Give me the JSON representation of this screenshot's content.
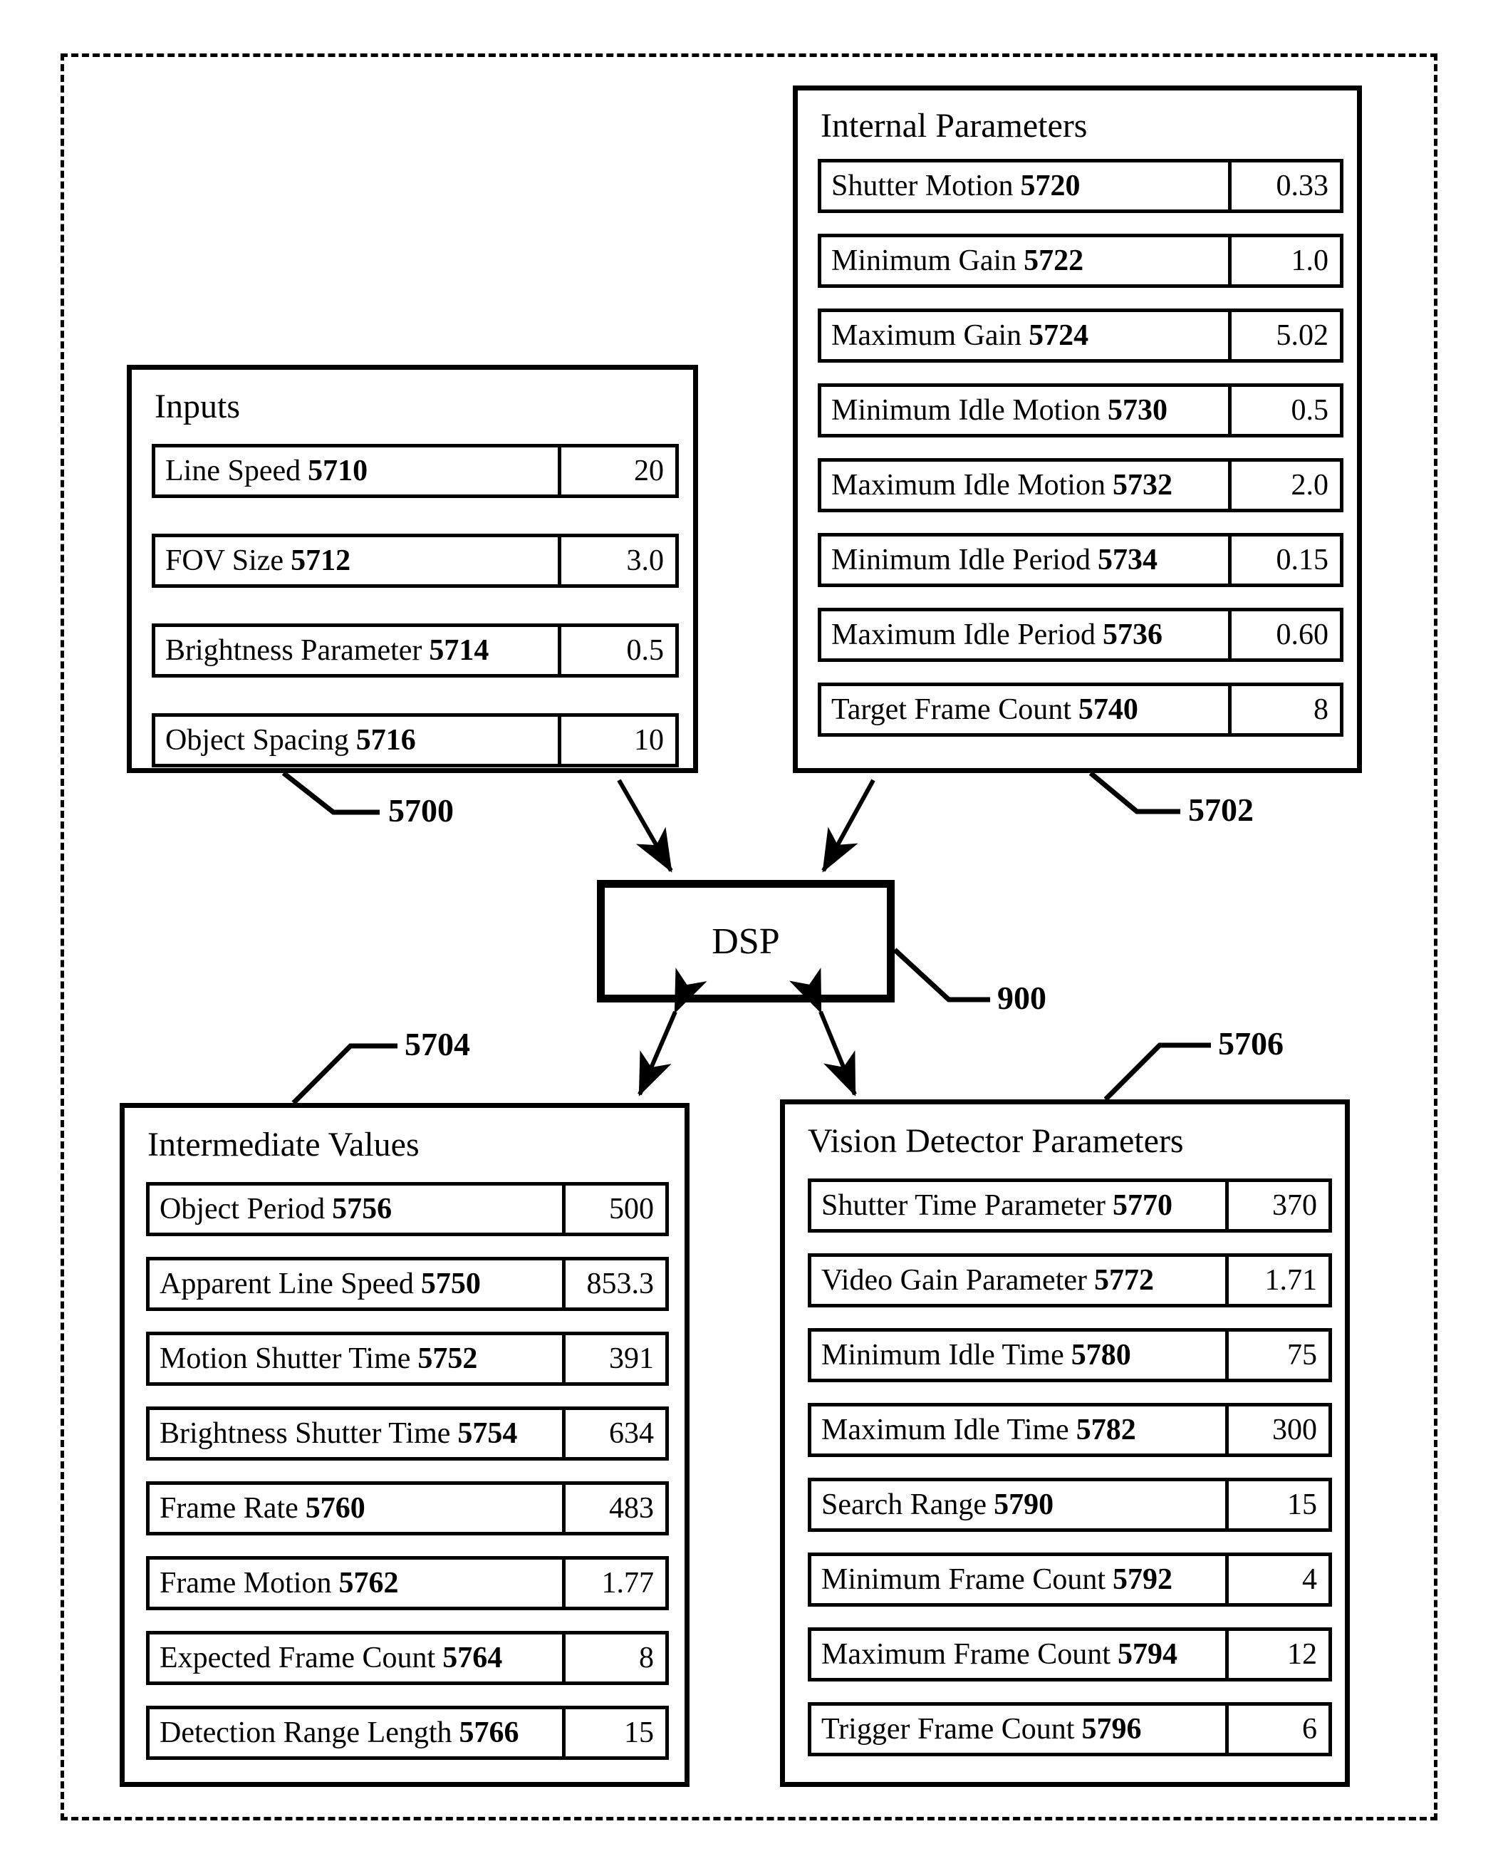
{
  "figure": {
    "central_block": {
      "label": "DSP",
      "ref": "900"
    }
  },
  "panels": {
    "inputs": {
      "title": "Inputs",
      "ref": "5700",
      "rows": [
        {
          "label": "Line Speed",
          "ref": "5710",
          "value": "20"
        },
        {
          "label": "FOV Size",
          "ref": "5712",
          "value": "3.0"
        },
        {
          "label": "Brightness Parameter",
          "ref": "5714",
          "value": "0.5"
        },
        {
          "label": "Object Spacing",
          "ref": "5716",
          "value": "10"
        }
      ]
    },
    "internal_parameters": {
      "title": "Internal Parameters",
      "ref": "5702",
      "rows": [
        {
          "label": "Shutter Motion",
          "ref": "5720",
          "value": "0.33"
        },
        {
          "label": "Minimum Gain",
          "ref": "5722",
          "value": "1.0"
        },
        {
          "label": "Maximum Gain",
          "ref": "5724",
          "value": "5.02"
        },
        {
          "label": "Minimum Idle Motion",
          "ref": "5730",
          "value": "0.5"
        },
        {
          "label": "Maximum Idle Motion",
          "ref": "5732",
          "value": "2.0"
        },
        {
          "label": "Minimum Idle Period",
          "ref": "5734",
          "value": "0.15"
        },
        {
          "label": "Maximum Idle Period",
          "ref": "5736",
          "value": "0.60"
        },
        {
          "label": "Target Frame Count",
          "ref": "5740",
          "value": "8"
        }
      ]
    },
    "intermediate_values": {
      "title": "Intermediate Values",
      "ref": "5704",
      "rows": [
        {
          "label": "Object Period",
          "ref": "5756",
          "value": "500"
        },
        {
          "label": "Apparent Line Speed",
          "ref": "5750",
          "value": "853.3"
        },
        {
          "label": "Motion Shutter Time",
          "ref": "5752",
          "value": "391"
        },
        {
          "label": "Brightness Shutter Time",
          "ref": "5754",
          "value": "634"
        },
        {
          "label": "Frame Rate",
          "ref": "5760",
          "value": "483"
        },
        {
          "label": "Frame Motion",
          "ref": "5762",
          "value": "1.77"
        },
        {
          "label": "Expected Frame Count",
          "ref": "5764",
          "value": "8"
        },
        {
          "label": "Detection Range Length",
          "ref": "5766",
          "value": "15"
        }
      ]
    },
    "vision_detector_parameters": {
      "title": "Vision Detector Parameters",
      "ref": "5706",
      "rows": [
        {
          "label": "Shutter Time Parameter",
          "ref": "5770",
          "value": "370"
        },
        {
          "label": "Video Gain Parameter",
          "ref": "5772",
          "value": "1.71"
        },
        {
          "label": "Minimum Idle Time",
          "ref": "5780",
          "value": "75"
        },
        {
          "label": "Maximum Idle Time",
          "ref": "5782",
          "value": "300"
        },
        {
          "label": "Search Range",
          "ref": "5790",
          "value": "15"
        },
        {
          "label": "Minimum Frame Count",
          "ref": "5792",
          "value": "4"
        },
        {
          "label": "Maximum Frame Count",
          "ref": "5794",
          "value": "12"
        },
        {
          "label": "Trigger Frame Count",
          "ref": "5796",
          "value": "6"
        }
      ]
    }
  }
}
